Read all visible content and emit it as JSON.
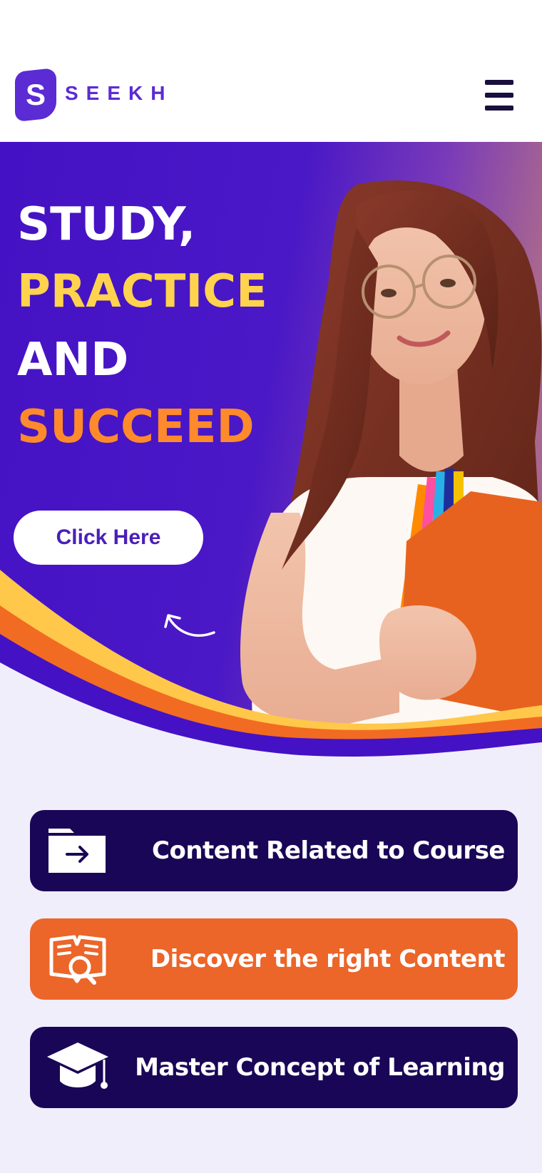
{
  "brand": {
    "logo_letter": "S",
    "name": "SEEKH"
  },
  "hero": {
    "headline": [
      {
        "text": "STUDY,",
        "color": "#ffffff"
      },
      {
        "text": "PRACTICE",
        "color": "#ffd34d"
      },
      {
        "text": "AND",
        "color": "#ffffff"
      },
      {
        "text": "SUCCEED",
        "color": "#ff8a2b"
      }
    ],
    "cta_label": "Click Here"
  },
  "features": [
    {
      "label": "Content Related to Course",
      "icon": "folder-arrow-icon",
      "color": "#1a0656"
    },
    {
      "label": "Discover the right Content",
      "icon": "book-search-icon",
      "color": "#ec6529"
    },
    {
      "label": "Master Concept of Learning",
      "icon": "graduation-cap-icon",
      "color": "#1a0656"
    }
  ],
  "colors": {
    "primary": "#4a17c9",
    "accent_yellow": "#ffd34d",
    "accent_orange": "#ec6529",
    "dark_navy": "#1a0656",
    "background": "#f1eefb"
  }
}
